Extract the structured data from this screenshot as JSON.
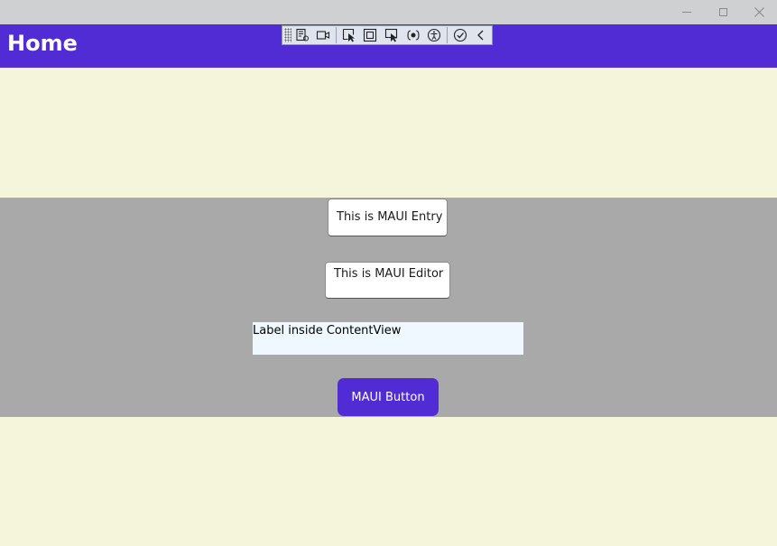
{
  "window": {
    "controls": [
      "minimize",
      "maximize",
      "close"
    ]
  },
  "navbar": {
    "title": "Home",
    "background": "#512bd4"
  },
  "dev_toolbar": {
    "icons": [
      "live-visual-tree-icon",
      "record-icon",
      "select-element-icon",
      "display-adorners-icon",
      "track-focus-icon",
      "binding-failures-icon",
      "accessibility-icon",
      "hot-reload-status-icon",
      "collapse-icon"
    ]
  },
  "page": {
    "background": "#f5f5dc",
    "band_background": "#a9a9a9",
    "entry_text": "This is MAUI Entry",
    "editor_text": "This is MAUI Editor",
    "content_view_label": "Label inside ContentView",
    "content_view_background": "#f0f8ff",
    "button_label": "MAUI Button"
  }
}
